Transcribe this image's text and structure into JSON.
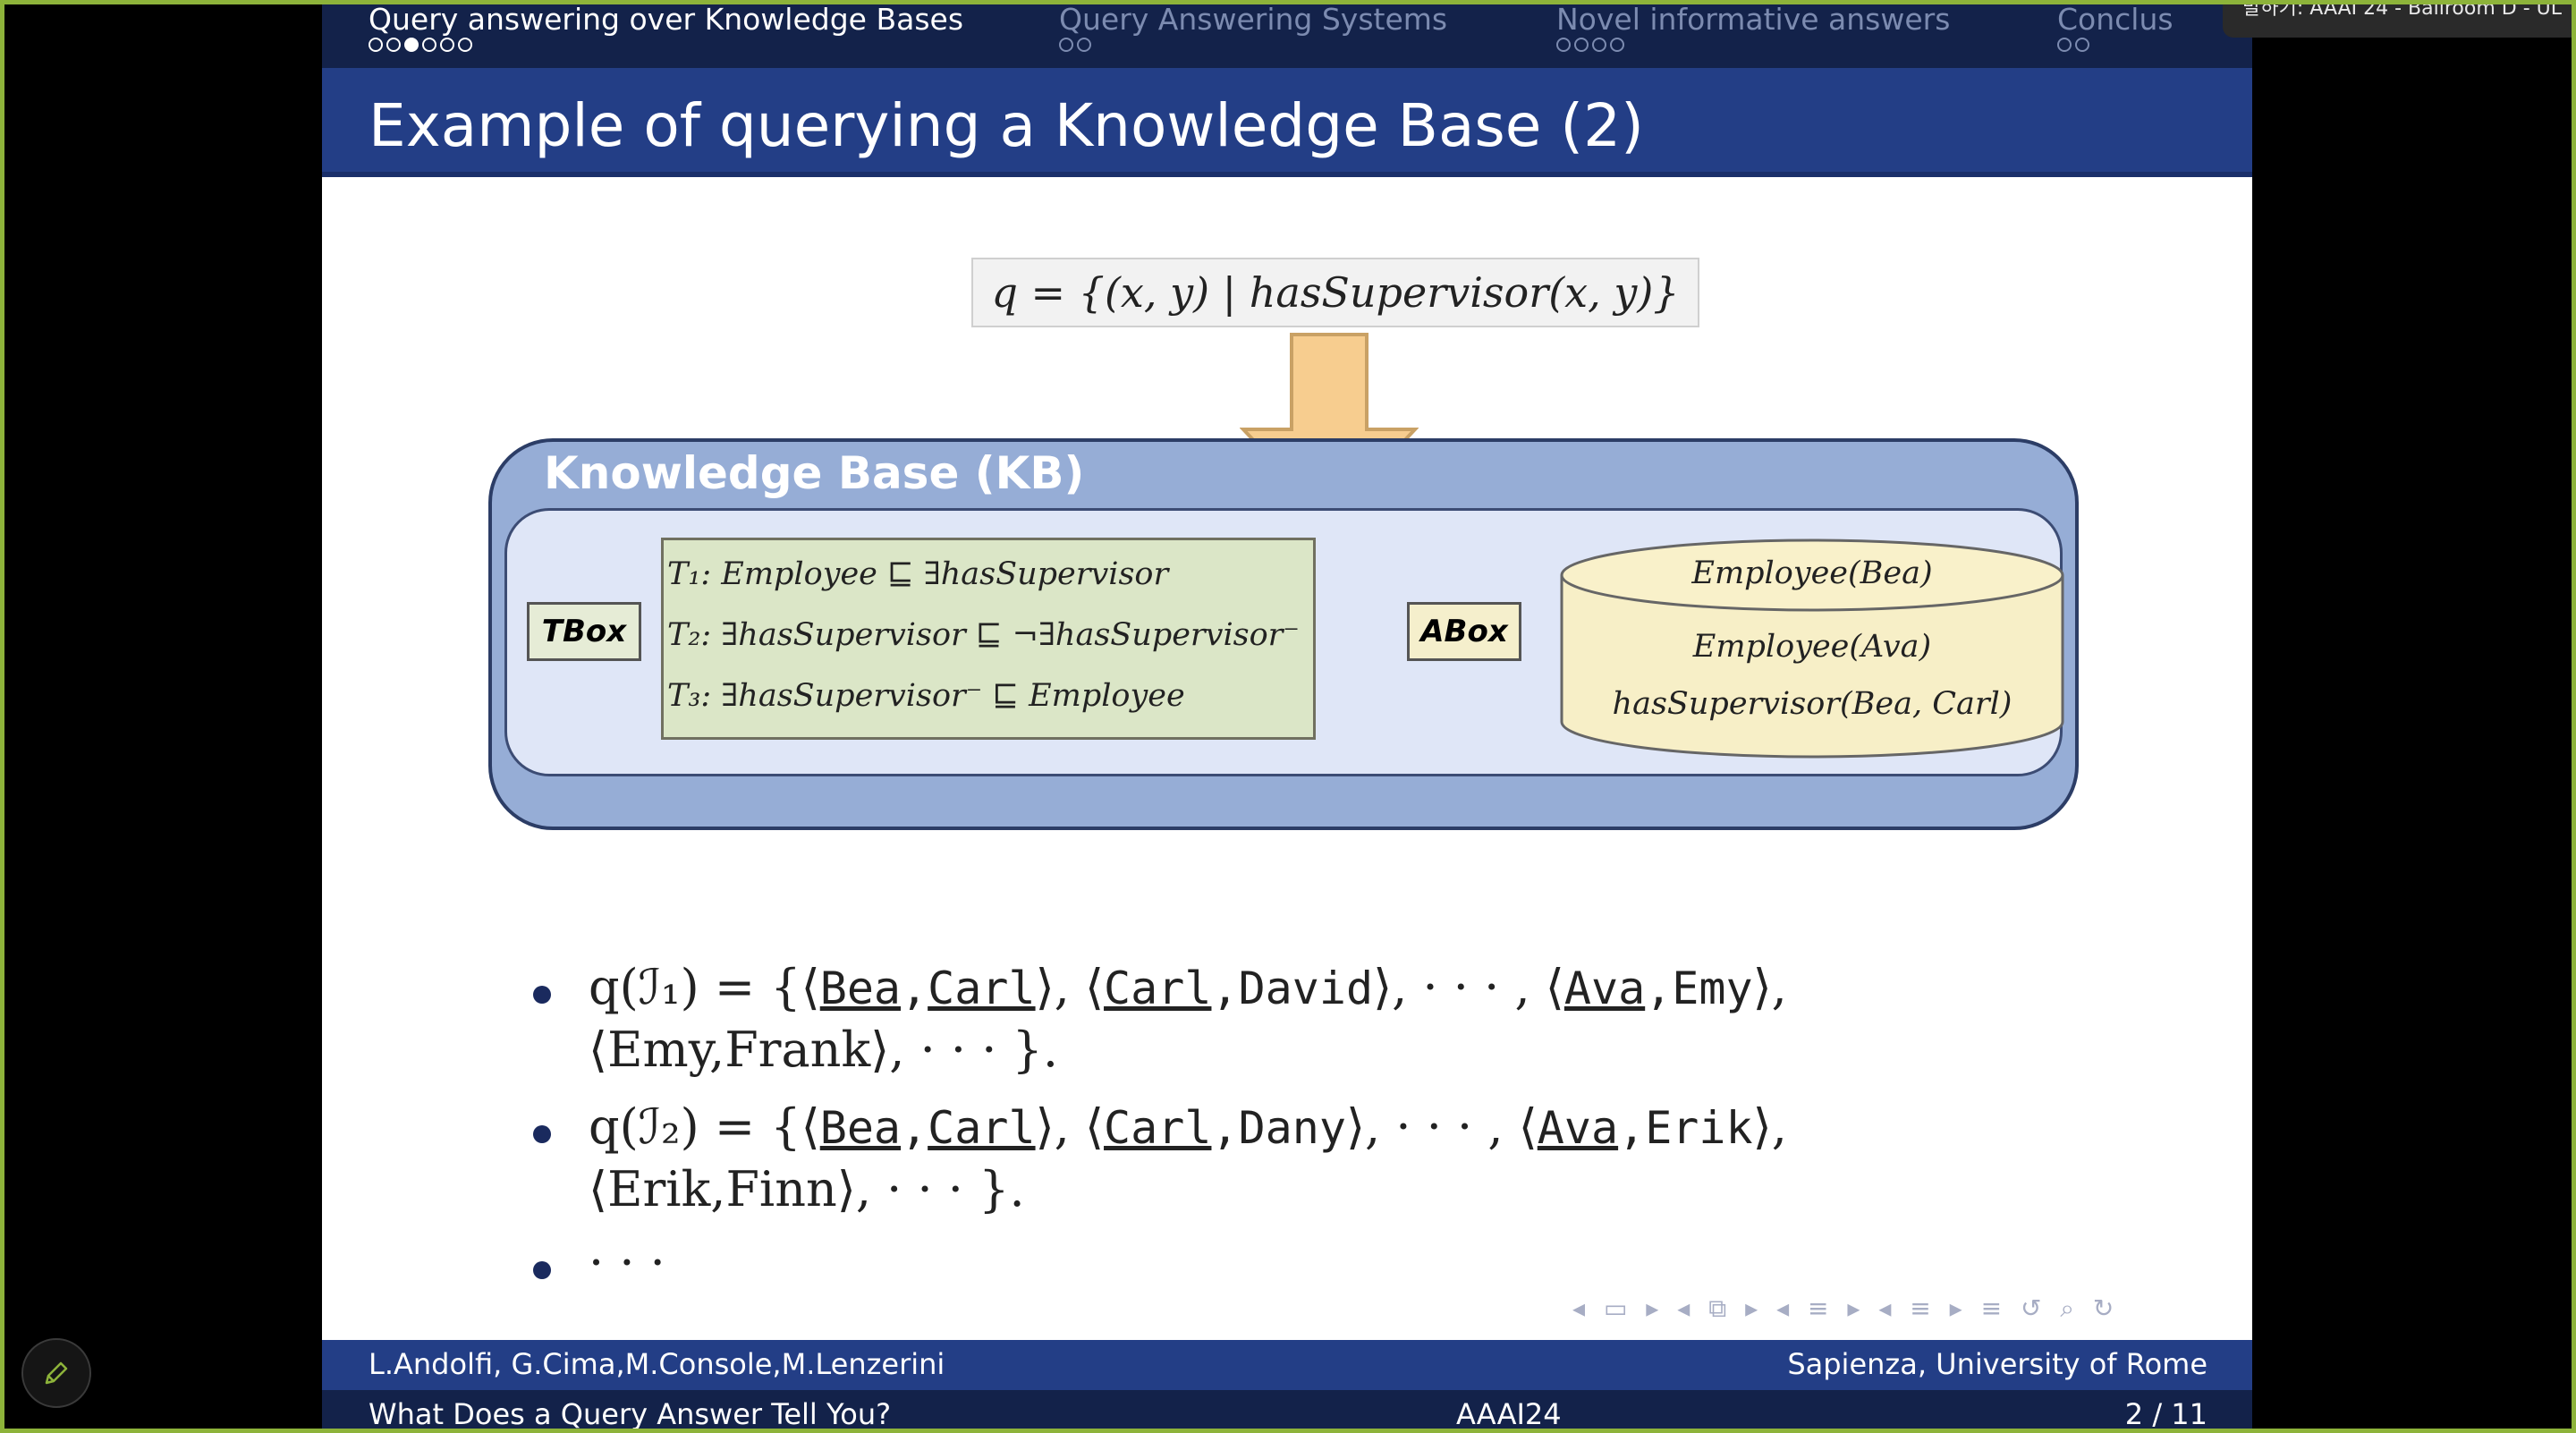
{
  "overlay": {
    "speaker_label": "발하기: AAAI 24 - Ballroom D - UL"
  },
  "nav": {
    "sections": [
      {
        "label": "Query answering over Knowledge Bases",
        "dots": 6,
        "filled_index": 2
      },
      {
        "label": "Query Answering Systems",
        "dots": 2
      },
      {
        "label": "Novel informative answers",
        "dots": 4
      },
      {
        "label": "Conclus",
        "dots": 2
      }
    ]
  },
  "slide": {
    "title": "Example of querying a Knowledge Base (2)",
    "query": "q = {(x, y) | hasSupervisor(x, y)}",
    "kb": {
      "label": "Knowledge Base (KB)",
      "tbox_label": "TBox",
      "abox_label": "ABox",
      "tbox_axioms": [
        "T₁: Employee ⊑ ∃hasSupervisor",
        "T₂: ∃hasSupervisor ⊑ ¬∃hasSupervisor⁻",
        "T₃: ∃hasSupervisor⁻ ⊑ Employee"
      ],
      "abox_facts": [
        "Employee(Bea)",
        "Employee(Ava)",
        "hasSupervisor(Bea, Carl)"
      ]
    },
    "bullets": {
      "b1_prefix": "q(ℐ₁) = {⟨",
      "b1_line2": "⟨Emy,Frank⟩, · · · }.",
      "b2_prefix": "q(ℐ₂) = {⟨",
      "b2_line2": "⟨Erik,Finn⟩, · · · }.",
      "b3": "· · ·",
      "t_bea": "Bea",
      "t_carl": "Carl",
      "t_ava": "Ava",
      "t_david": "David",
      "t_emy": "Emy",
      "t_dany": "Dany",
      "t_erik": "Erik",
      "sep1": ",",
      "close_open": "⟩, ⟨",
      "mid_dots": "⟩, · · · , ⟨",
      "end_open": "⟩,"
    },
    "nav_symbols": "◂ ▭ ▸  ◂ ⧉ ▸  ◂ ≡ ▸  ◂ ≡ ▸   ≡   ↺ ⌕ ↻",
    "footer": {
      "authors": "L.Andolfi, G.Cima,M.Console,M.Lenzerini",
      "affiliation": "Sapienza, University of Rome",
      "paper_title": "What Does a Query Answer Tell You?",
      "venue": "AAAI24",
      "page": "2 / 11"
    }
  },
  "colors": {
    "nav_dark": "#13224a",
    "title_blue": "#233e86",
    "frame_green": "#8db33a"
  }
}
